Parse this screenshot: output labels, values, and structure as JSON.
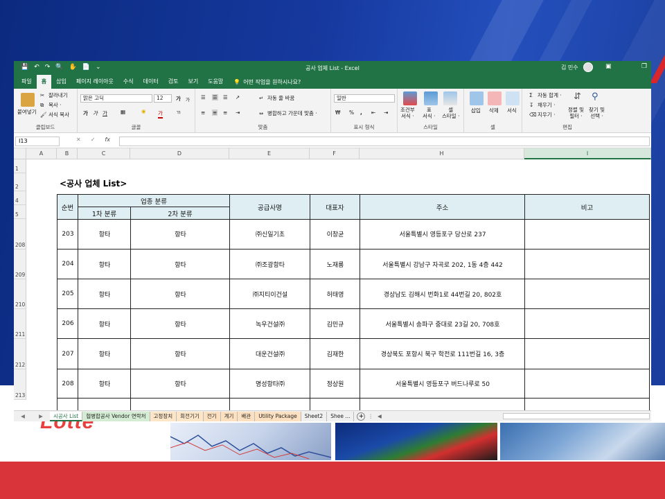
{
  "colors": {
    "excel_green": "#217346",
    "header_fill": "#dfeef3",
    "slide_blue": "#16399f",
    "slide_red": "#d8343a"
  },
  "window": {
    "title": "공사 업체 List - Excel",
    "user": "김 민수",
    "qat_icons": [
      "save-icon",
      "undo-icon",
      "redo-icon",
      "print-preview-icon",
      "touch-mode-icon",
      "new-file-icon"
    ]
  },
  "tabs": [
    "파일",
    "홈",
    "삽입",
    "페이지 레이아웃",
    "수식",
    "데이터",
    "검토",
    "보기",
    "도움말"
  ],
  "active_tab": "홈",
  "tell_me": "어떤 작업을 원하시나요?",
  "ribbon": {
    "clipboard": {
      "paste": "붙여넣기",
      "cut": "잘라내기",
      "copy": "복사 ·",
      "format_painter": "서식 복사",
      "label": "클립보드"
    },
    "font": {
      "name": "맑은 고딕",
      "size": "12",
      "grow": "가",
      "shrink": "가",
      "bold": "가",
      "italic": "가",
      "underline": "가",
      "color": "가",
      "label": "글꼴"
    },
    "alignment": {
      "wrap": "자동 줄 바꿈",
      "merge": "병합하고 가운데 맞춤 ·",
      "label": "맞춤"
    },
    "number": {
      "format": "일반",
      "percent": "%",
      "comma": ",",
      "label": "표시 형식"
    },
    "styles": {
      "conditional": "조건부\n서식 ·",
      "table": "표\n서식 ·",
      "cell": "셀\n스타일 ·",
      "label": "스타일"
    },
    "cells": {
      "insert": "삽입",
      "delete": "삭제",
      "format": "서식",
      "label": "셀"
    },
    "editing": {
      "autosum": "자동 합계 ·",
      "fill": "채우기 ·",
      "clear": "지우기 ·",
      "sort": "정렬 및\n필터 ·",
      "find": "찾기 및\n선택 ·",
      "label": "편집"
    }
  },
  "formula_bar": {
    "name_box": "I13",
    "value": ""
  },
  "columns": [
    "A",
    "B",
    "C",
    "D",
    "E",
    "F",
    "H",
    "I"
  ],
  "selected_column": "I",
  "rows": [
    "1",
    "2",
    "4",
    "5",
    "208",
    "209",
    "210",
    "211",
    "212",
    "213"
  ],
  "sheet_title": "<공사 업체 List>",
  "table": {
    "headers": {
      "seq": "순번",
      "category": "업종 분류",
      "cat1": "1차 분류",
      "cat2": "2차 분류",
      "supplier": "공급사명",
      "ceo": "대표자",
      "address": "주소",
      "note": "비고"
    },
    "rows": [
      {
        "seq": "203",
        "cat1": "항타",
        "cat2": "항타",
        "supplier": "㈜신일기초",
        "ceo": "이창균",
        "address": "서울특별시 영등포구 당산로 237",
        "note": ""
      },
      {
        "seq": "204",
        "cat1": "항타",
        "cat2": "항타",
        "supplier": "㈜조광항타",
        "ceo": "노재룡",
        "address": "서울특별시 강남구 자곡로 202, 1동 4층 442",
        "note": ""
      },
      {
        "seq": "205",
        "cat1": "항타",
        "cat2": "항타",
        "supplier": "㈜지티이건설",
        "ceo": "허태영",
        "address": "경상남도 김해시 번화1로 44번길 20, 802호",
        "note": ""
      },
      {
        "seq": "206",
        "cat1": "항타",
        "cat2": "항타",
        "supplier": "녹우건설㈜",
        "ceo": "김민규",
        "address": "서울특별시 송파구 중대로 23길 20, 708호",
        "note": ""
      },
      {
        "seq": "207",
        "cat1": "항타",
        "cat2": "항타",
        "supplier": "대운건설㈜",
        "ceo": "김재한",
        "address": "경상북도 포항시 북구 학전로 111번길 16, 3층",
        "note": ""
      },
      {
        "seq": "208",
        "cat1": "항타",
        "cat2": "항타",
        "supplier": "명성항타㈜",
        "ceo": "정상원",
        "address": "서울특별시 영등포구 버드나루로 50",
        "note": ""
      }
    ]
  },
  "sheets": [
    "시공사 List",
    "협병합공사 Vendor 연락처",
    "고정장치",
    "회전기기",
    "전기",
    "계기",
    "배관",
    "Utility Package",
    "Sheet2",
    "Shee ..."
  ],
  "active_sheet": "시공사 List",
  "slide_logo": "Lotte"
}
